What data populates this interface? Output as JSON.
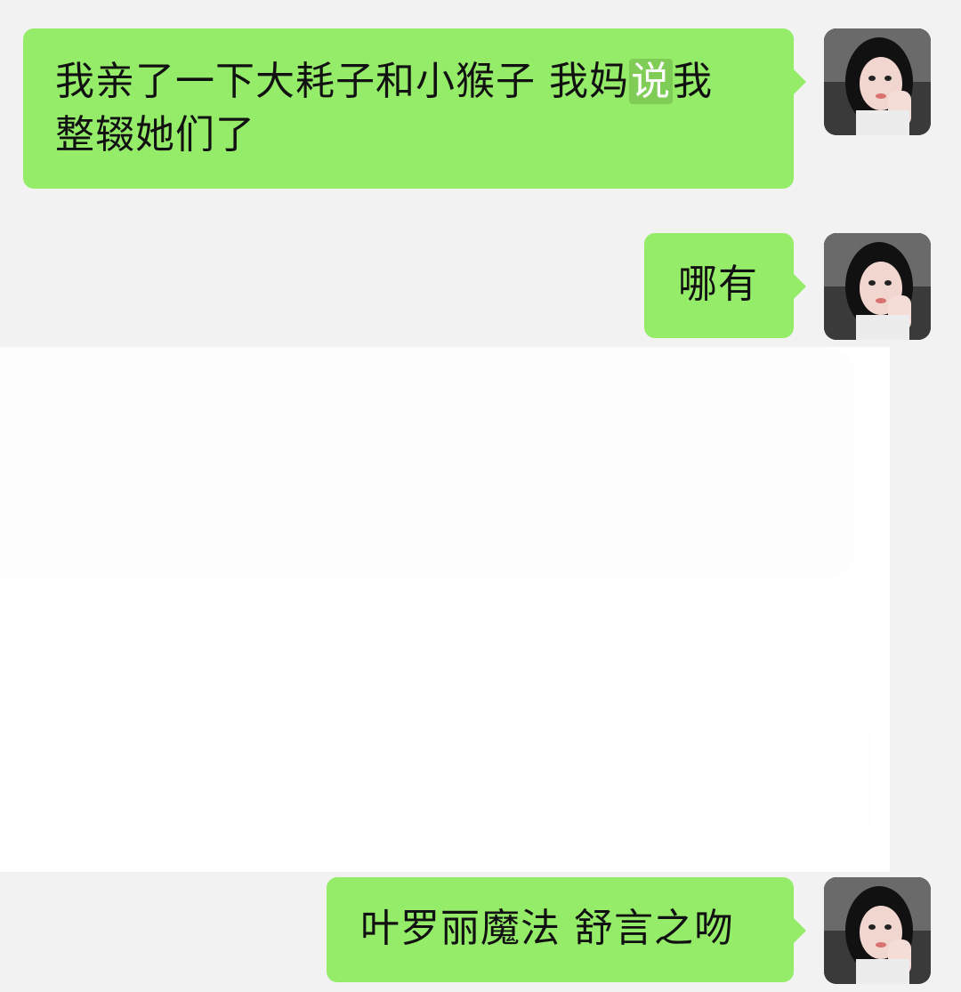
{
  "colors": {
    "background": "#f2f2f2",
    "bubble": "#95ec69",
    "highlight": "#7fcd57"
  },
  "messages": [
    {
      "sender": "self",
      "lines": [
        "我亲了一下大耗子和小猴子 我妈",
        "说",
        "我",
        "整辍她们了"
      ],
      "highlight": "说"
    },
    {
      "sender": "self",
      "text": "哪有"
    },
    {
      "sender": "self",
      "text": "叶罗丽魔法 舒言之吻"
    }
  ],
  "avatar": {
    "icon": "user-photo-icon"
  }
}
